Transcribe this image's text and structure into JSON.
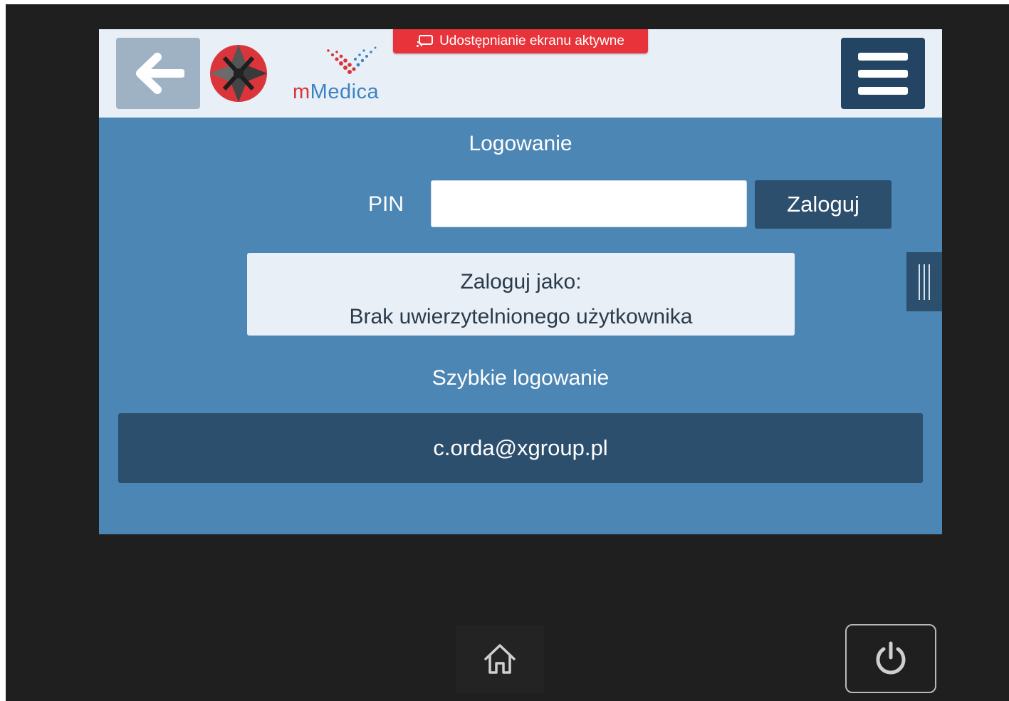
{
  "header": {
    "back_icon": "arrow-left-icon",
    "brand_logo": "x-logo",
    "app_logo_text_m": "m",
    "app_logo_text_rest": "Medica",
    "share_banner": {
      "icon": "cast-icon",
      "text": "Udostępnianie ekranu aktywne",
      "color": "#e8333a"
    },
    "menu_icon": "hamburger-menu-icon"
  },
  "login": {
    "title": "Logowanie",
    "pin_label": "PIN",
    "pin_value": "",
    "submit_label": "Zaloguj",
    "login_as_label": "Zaloguj jako:",
    "login_as_user": "Brak uwierzytelnionego użytkownika"
  },
  "quick_login": {
    "title": "Szybkie logowanie",
    "users": [
      "c.orda@xgroup.pl"
    ]
  },
  "side_panel": {
    "handle_icon": "panel-handle-icon"
  },
  "device_bar": {
    "home_icon": "home-icon",
    "power_icon": "power-icon"
  },
  "colors": {
    "screen_bg": "#4c86b5",
    "header_bg": "#e8eff7",
    "dark_button": "#2c4f6d",
    "frame_bg": "#1f1f1f"
  }
}
